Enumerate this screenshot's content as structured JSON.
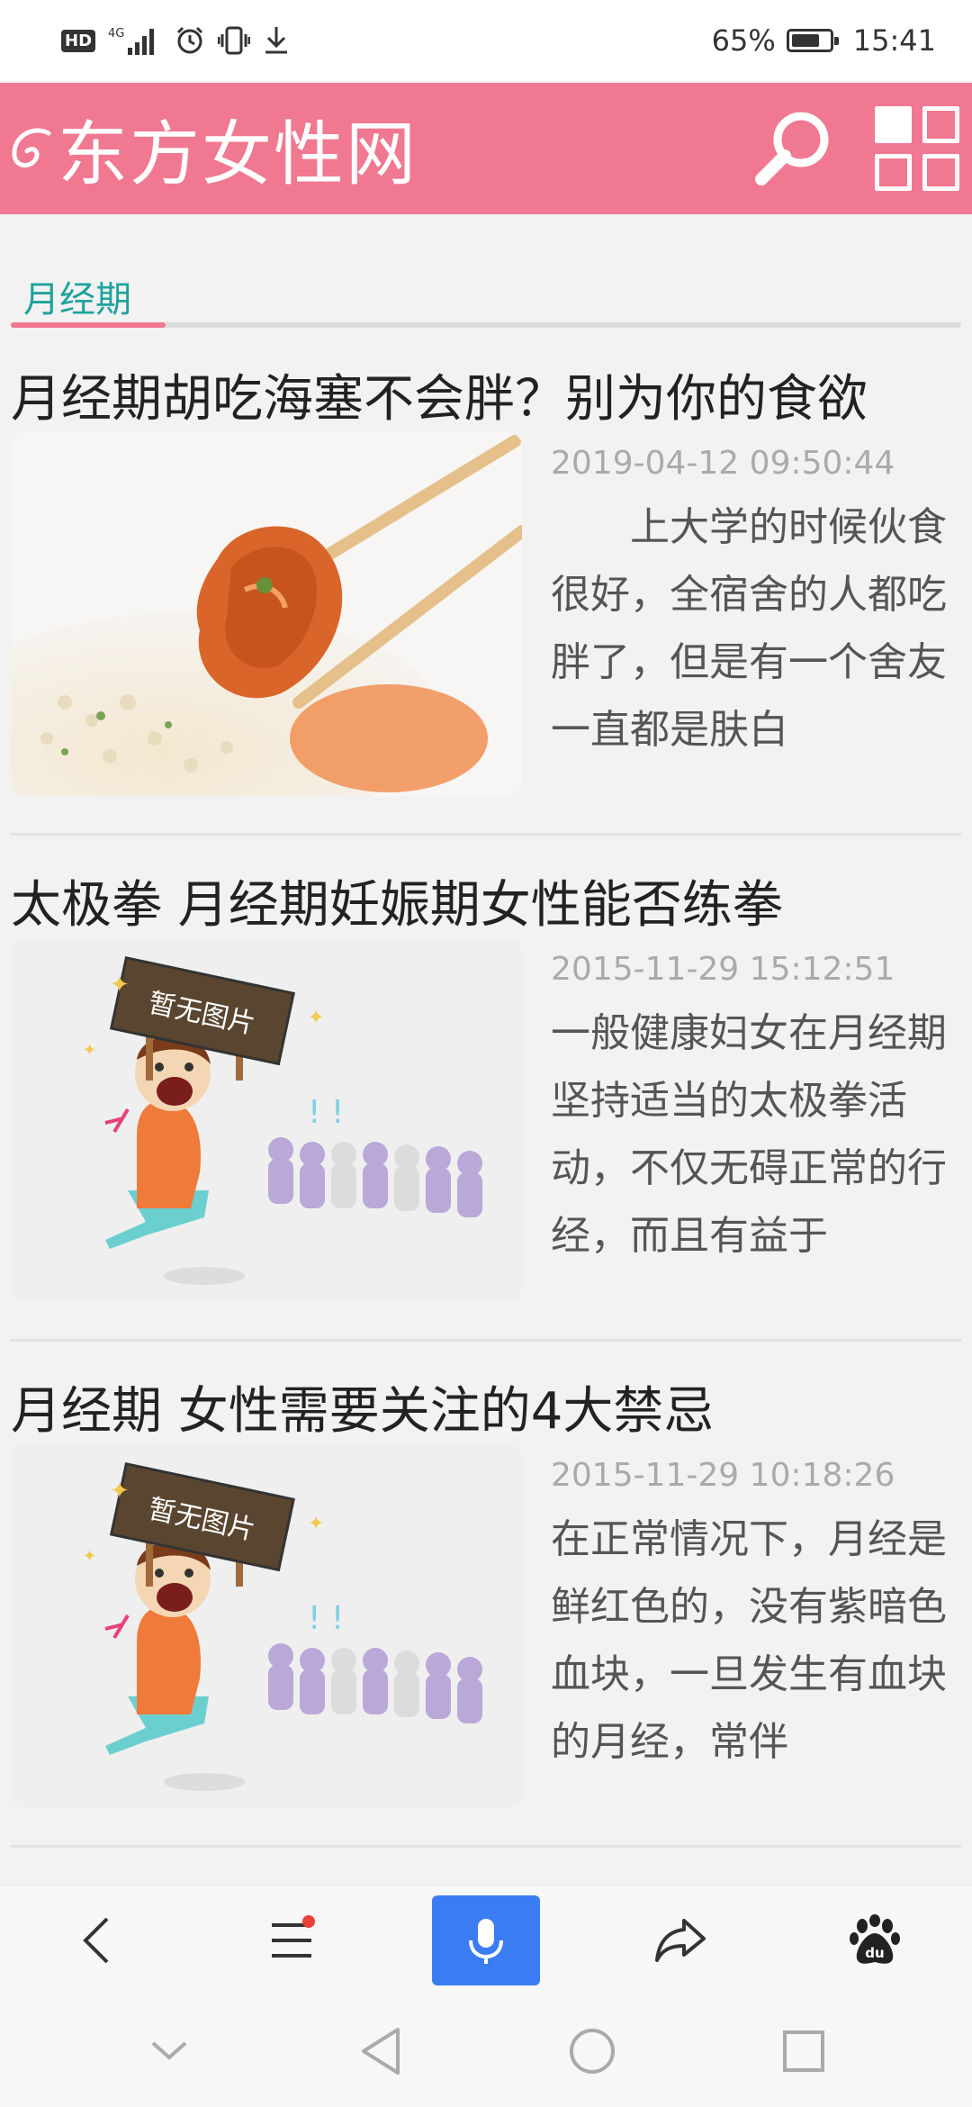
{
  "status_bar": {
    "hd": "HD",
    "network": "4G",
    "battery_percent_text": "65%",
    "battery_level": 0.65,
    "time": "15:41"
  },
  "header": {
    "logo_text": "东方女性网",
    "brand_color": "#f07890",
    "icons": [
      "search-icon",
      "grid-menu-icon"
    ]
  },
  "category": {
    "label": "月经期",
    "accent_color": "#1ea39a"
  },
  "articles": [
    {
      "title": "月经期胡吃海塞不会胖？别为你的食欲",
      "date": "2019-04-12 09:50:44",
      "summary": "　　上大学的时候伙食很好，全宿舍的人都吃胖了，但是有一个舍友一直都是肤白",
      "image": "food-photo"
    },
    {
      "title": "太极拳 月经期妊娠期女性能否练拳",
      "date": "2015-11-29 15:12:51",
      "summary": "一般健康妇女在月经期坚持适当的太极拳活动，不仅无碍正常的行经，而且有益于",
      "image": "no-image-placeholder",
      "placeholder_text": "暂无图片"
    },
    {
      "title": "月经期 女性需要关注的4大禁忌",
      "date": "2015-11-29 10:18:26",
      "summary": "在正常情况下，月经是鲜红色的，没有紫暗色血块，一旦发生有血块的月经，常伴",
      "image": "no-image-placeholder",
      "placeholder_text": "暂无图片"
    }
  ],
  "browser_bar": {
    "buttons": [
      "back-icon",
      "menu-icon",
      "microphone-icon",
      "share-icon",
      "baidu-paw-icon"
    ],
    "baidu_text": "du",
    "mic_color": "#3b7cf3"
  },
  "system_nav": {
    "buttons": [
      "collapse-chevron-icon",
      "nav-back-triangle-icon",
      "nav-home-circle-icon",
      "nav-recents-square-icon"
    ]
  }
}
